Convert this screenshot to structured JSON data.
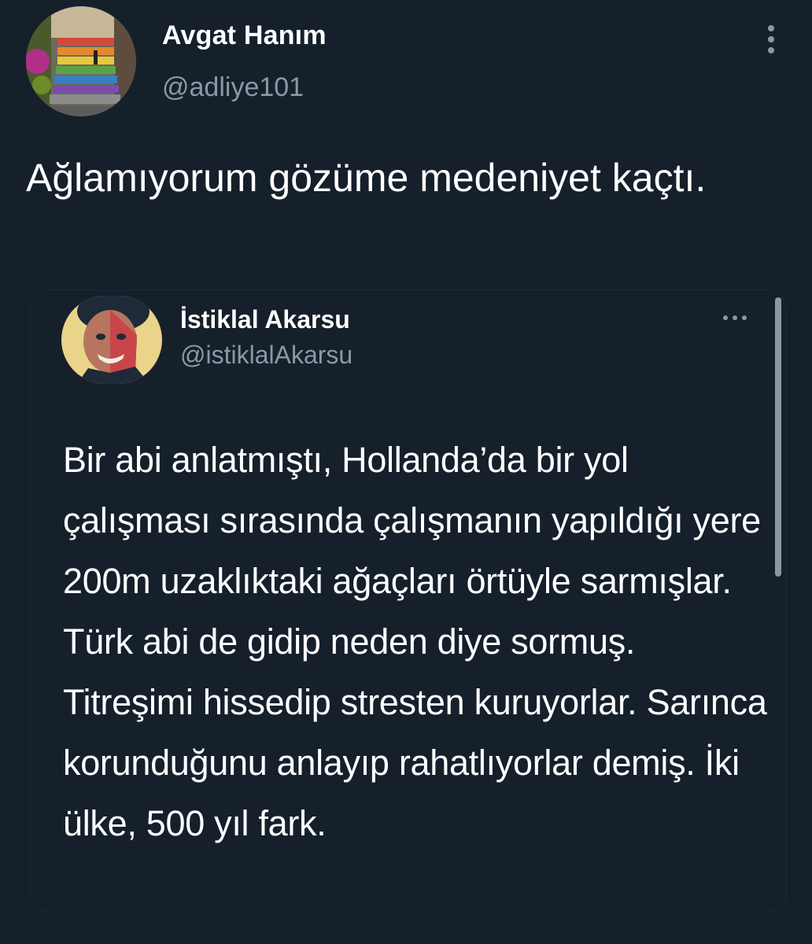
{
  "tweet": {
    "author": {
      "name": "Avgat Hanım",
      "handle": "@adliye101",
      "avatar_icon": "profile-photo-colorful-stairs"
    },
    "more_icon": "more-vertical-icon",
    "text": "Ağlamıyorum gözüme medeniyet kaçtı."
  },
  "quoted_tweet": {
    "author": {
      "name": "İstiklal Akarsu",
      "handle": "@istiklalAkarsu",
      "avatar_icon": "profile-photo-man-portrait"
    },
    "more_icon": "more-horizontal-icon",
    "text": "Bir abi anlatmıştı, Hollanda’da bir yol çalışması sırasında çalışmanın yapıldığı yere 200m uzaklıktaki ağaçları örtüyle sarmışlar. Türk abi de gidip neden diye sormuş. Titreşimi hissedip stresten kuruyorlar. Sarınca korunduğunu anlayıp rahatlıyorlar demiş. İki ülke, 500 yıl fark."
  },
  "colors": {
    "background": "#15202b",
    "primary_text": "#ffffff",
    "secondary_text": "#8899a6",
    "card_border": "#1c2a37"
  }
}
